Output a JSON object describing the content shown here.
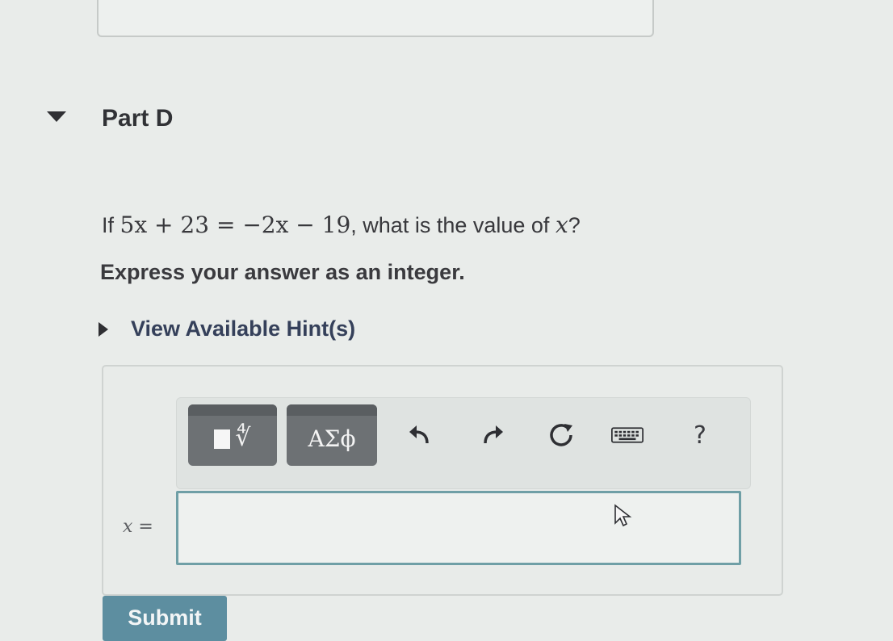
{
  "part": {
    "title": "Part D"
  },
  "question": {
    "prefix": "If",
    "equation_left": "5x + 23",
    "equals": "=",
    "equation_right": "−2x − 19",
    "suffix": ", what is the value of",
    "variable": "x",
    "end": "?"
  },
  "instruction": "Express your answer as an integer.",
  "hints": {
    "label": "View Available Hint(s)"
  },
  "toolbar": {
    "symbols_label": "ΑΣϕ",
    "radical_label": "∜",
    "help_label": "?"
  },
  "answer": {
    "variable_label": "x",
    "equals": "=",
    "value": ""
  },
  "submit": {
    "label": "Submit"
  },
  "colors": {
    "background": "#e9ecea",
    "toolbar_button": "#6d7174",
    "input_border": "#6f9fa6",
    "submit": "#5d8ea0"
  }
}
